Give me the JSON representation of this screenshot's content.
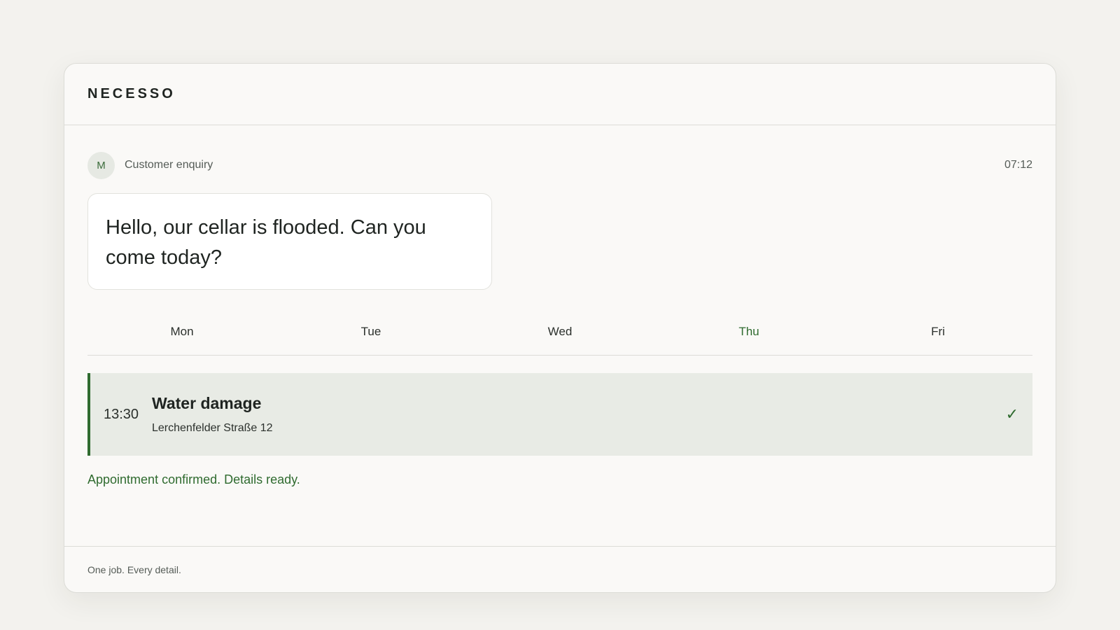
{
  "app": {
    "brand": "NECESSO"
  },
  "enquiry": {
    "avatar_initial": "M",
    "label": "Customer enquiry",
    "time": "07:12",
    "message": "Hello, our cellar is flooded. Can you come today?"
  },
  "calendar": {
    "days": [
      {
        "label": "Mon",
        "active": false
      },
      {
        "label": "Tue",
        "active": false
      },
      {
        "label": "Wed",
        "active": false
      },
      {
        "label": "Thu",
        "active": true
      },
      {
        "label": "Fri",
        "active": false
      }
    ]
  },
  "appointment": {
    "time": "13:30",
    "title": "Water damage",
    "address": "Lerchenfelder Straße 12",
    "status_icon": "check-icon",
    "status_glyph": "✓"
  },
  "status": {
    "confirmation": "Appointment confirmed. Details ready."
  },
  "footer": {
    "tagline": "One job. Every detail."
  },
  "colors": {
    "accent": "#2f6b2f",
    "background": "#f3f2ee",
    "card": "#faf9f7",
    "appointment_bg": "#e8ebe5"
  }
}
